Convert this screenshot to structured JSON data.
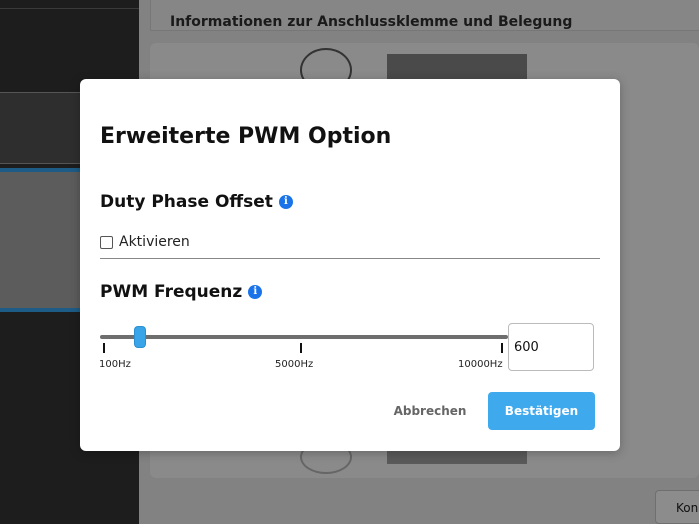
{
  "background": {
    "header_title": "Informationen zur Anschlussklemme und Belegung",
    "konfig_button_label": "Kon"
  },
  "modal": {
    "title": "Erweiterte PWM Option",
    "duty_section": {
      "title": "Duty Phase Offset",
      "info_icon": "info-icon",
      "checkbox_label": "Aktivieren",
      "checked": false
    },
    "pwm_section": {
      "title": "PWM Frequenz",
      "info_icon": "info-icon",
      "slider": {
        "min": 100,
        "max": 10000,
        "value": 600,
        "tick_labels": [
          "100Hz",
          "5000Hz",
          "10000Hz"
        ]
      },
      "input_value": "600"
    },
    "cancel_label": "Abbrechen",
    "confirm_label": "Bestätigen"
  },
  "colors": {
    "accent": "#3fa9ee",
    "info": "#1a73e8"
  }
}
